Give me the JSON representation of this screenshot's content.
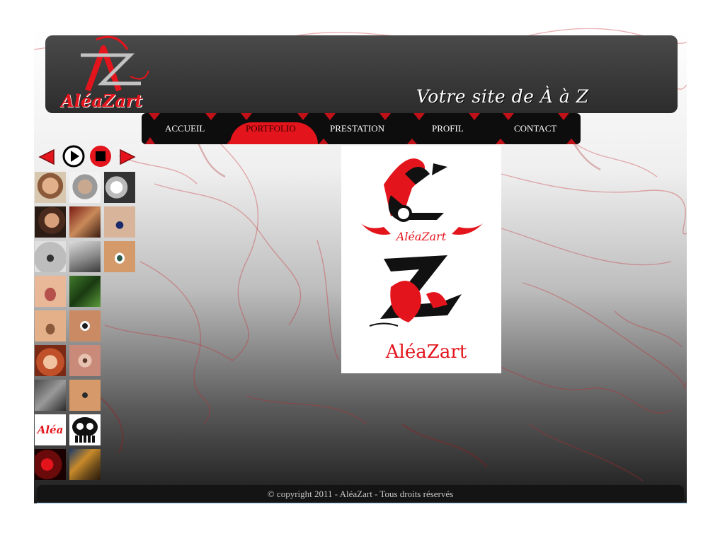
{
  "header": {
    "logo_text": "AléaZart",
    "logo_monogram": "AZ",
    "tagline": "Votre site de À à Z"
  },
  "nav": {
    "items": [
      {
        "label": "ACCUEIL",
        "active": false
      },
      {
        "label": "PORTFOLIO",
        "active": true
      },
      {
        "label": "PRESTATION",
        "active": false
      },
      {
        "label": "PROFIL",
        "active": false
      },
      {
        "label": "CONTACT",
        "active": false
      }
    ]
  },
  "slideshow": {
    "controls": [
      "prev-arrow-icon",
      "play-icon",
      "stop-icon",
      "next-arrow-icon"
    ]
  },
  "thumbnails": [
    "portrait woman",
    "portrait woman gray hair",
    "white flowers",
    "portrait woman dark hair",
    "bracelet",
    "pendant",
    "silver pendant",
    "face closeup",
    "eye closeup",
    "lips closeup",
    "hand with leaves",
    "",
    "nose closeup",
    "eye dark",
    "",
    "smiling woman",
    "eye closeup pink",
    "",
    "hand ring",
    "eye makeup",
    "",
    "Aléa logo",
    "skull",
    "",
    "red smoke",
    "fantasy warrior",
    ""
  ],
  "main_image": {
    "logo_top_text": "AléaZart",
    "logo_bottom_text": "AléaZart"
  },
  "footer": {
    "copyright": "© copyright 2011 - AléaZart - Tous droits réservés"
  },
  "colors": {
    "accent_red": "#e3141c",
    "dark": "#2c2c2c"
  }
}
